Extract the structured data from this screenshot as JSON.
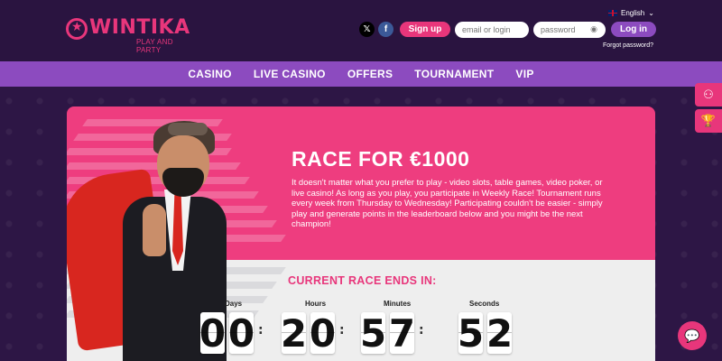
{
  "header": {
    "logo_text": "WINTIKA",
    "logo_tagline": "PLAY AND PARTY",
    "signup_label": "Sign up",
    "email_placeholder": "email or login",
    "password_placeholder": "password",
    "login_label": "Log in",
    "forgot_label": "Forgot password?",
    "language": "English"
  },
  "nav": {
    "items": [
      {
        "label": "CASINO"
      },
      {
        "label": "LIVE CASINO"
      },
      {
        "label": "OFFERS"
      },
      {
        "label": "TOURNAMENT"
      },
      {
        "label": "VIP"
      }
    ]
  },
  "hero": {
    "title": "RACE FOR €1000",
    "description": "It doesn't matter what you prefer to play - video slots, table games, video poker, or live casino! As long as you play, you participate in Weekly Race! Tournament runs every week from Thursday to Wednesday! Participating couldn't be easier - simply play and generate points in the leaderboard below and you might be the next champion!",
    "countdown_title": "CURRENT RACE ENDS IN:",
    "labels": {
      "days": "Days",
      "hours": "Hours",
      "minutes": "Minutes",
      "seconds": "Seconds"
    },
    "digits": {
      "d1": "0",
      "d2": "0",
      "h1": "2",
      "h2": "0",
      "m1": "5",
      "m2": "7",
      "s1": "5",
      "s2": "2"
    },
    "colon": ":"
  },
  "icons": {
    "x": "𝕏",
    "facebook": "f",
    "eye": "◉",
    "chevron": "⌄",
    "side_1": "⚇",
    "side_2": "🏆",
    "chat": "💬"
  },
  "colors": {
    "brand_pink": "#e8367b",
    "brand_purple": "#8c4bbf",
    "background": "#2a1440"
  }
}
